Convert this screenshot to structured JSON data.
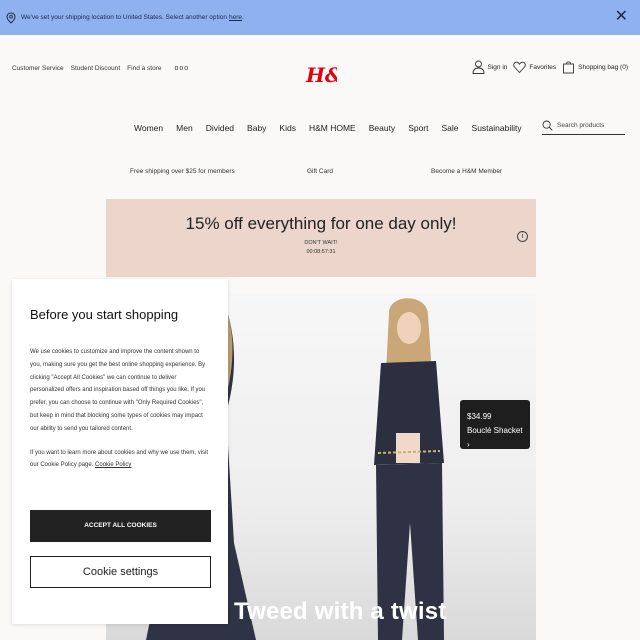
{
  "shipping_banner": {
    "text": "We've set your shipping location to United States. Select another option",
    "link": "here",
    "period": ".",
    "close": "✕"
  },
  "utility_left": [
    "Customer Service",
    "Student Discount",
    "Find a store"
  ],
  "utility_more": "ooo",
  "brand": {
    "logo_text": "H&M",
    "color": "#e50010"
  },
  "utility_right": {
    "signin": "Sign in",
    "favorites": "Favorites",
    "bag": "Shopping bag (0)"
  },
  "nav": [
    "Women",
    "Men",
    "Divided",
    "Baby",
    "Kids",
    "H&M HOME",
    "Beauty",
    "Sport",
    "Sale",
    "Sustainability"
  ],
  "search": {
    "placeholder": "Search products"
  },
  "promos": [
    "Free shipping over $25 for members",
    "Gift Card",
    "Become a H&M Member"
  ],
  "sale_banner": {
    "headline": "15% off everything for one day only!",
    "sub": "DON'T WAIT!",
    "timer": "00:08:57:31",
    "info": "i"
  },
  "hero": {
    "price": "$34.99",
    "product": "Bouclé Shacket",
    "chevron": "›",
    "title": "Tweed with a twist"
  },
  "cookie_modal": {
    "title": "Before you start shopping",
    "body": "We use cookies to customize and improve the content shown to you, making sure you get the best online shopping experience. By clicking \"Accept All Cookies\" we can continue to deliver personalized offers and inspiration based off things you like. If you prefer, you can choose to continue with \"Only Required Cookies\", but keep in mind that blocking some types of cookies may impact our ability to send you tailored content.",
    "body2": "If you want to learn more about cookies and why we use them, visit our Cookie Policy page.",
    "policy_link": "Cookie Policy",
    "accept_label": "ACCEPT ALL COOKIES",
    "settings_label": "Cookie settings"
  },
  "colors": {
    "banner_bg": "#8fb1f0",
    "sale_bg": "#ecd5cb",
    "dark": "#222222"
  }
}
